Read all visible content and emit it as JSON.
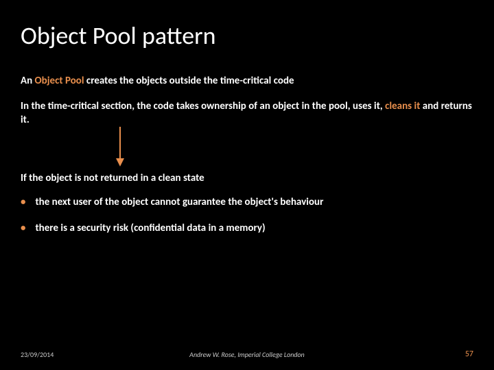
{
  "title": "Object Pool pattern",
  "p1_prefix": "An ",
  "p1_accent": "Object Pool ",
  "p1_suffix": "creates the objects outside the time-critical code",
  "p2a": "In the time-critical section, the code takes ownership of an object in the pool, uses it, ",
  "p2_accent": "cleans it",
  "p2b": " and returns it.",
  "p3": "If the object is not returned in a clean state",
  "bullets": [
    "the next user of the object cannot guarantee the object's behaviour",
    "there is a security risk (confidential data in a memory)"
  ],
  "footer": {
    "date": "23/09/2014",
    "center": "Andrew W. Rose, Imperial College London",
    "page": "57"
  },
  "colors": {
    "accent": "#e98f4d",
    "bg": "#000000",
    "text": "#ffffff"
  }
}
